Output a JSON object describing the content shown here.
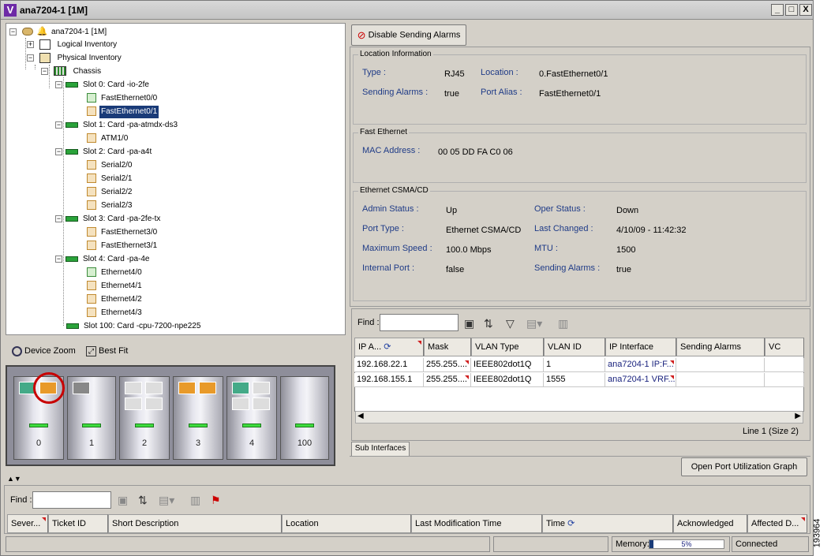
{
  "window": {
    "title": "ana7204-1 [1M]",
    "icon": "V",
    "min": "_",
    "max": "□",
    "close": "X"
  },
  "tree": {
    "root": "ana7204-1 [1M]",
    "logical": "Logical Inventory",
    "physical": "Physical Inventory",
    "chassis": "Chassis",
    "slot0": "Slot 0: Card -io-2fe",
    "slot0_p0": "FastEthernet0/0",
    "slot0_p1": "FastEthernet0/1",
    "slot1": "Slot 1: Card -pa-atmdx-ds3",
    "slot1_p0": "ATM1/0",
    "slot2": "Slot 2: Card -pa-a4t",
    "slot2_p0": "Serial2/0",
    "slot2_p1": "Serial2/1",
    "slot2_p2": "Serial2/2",
    "slot2_p3": "Serial2/3",
    "slot3": "Slot 3: Card -pa-2fe-tx",
    "slot3_p0": "FastEthernet3/0",
    "slot3_p1": "FastEthernet3/1",
    "slot4": "Slot 4: Card -pa-4e",
    "slot4_p0": "Ethernet4/0",
    "slot4_p1": "Ethernet4/1",
    "slot4_p2": "Ethernet4/2",
    "slot4_p3": "Ethernet4/3",
    "slot100": "Slot 100: Card -cpu-7200-npe225"
  },
  "zoom": {
    "device_zoom": "Device Zoom",
    "best_fit": "Best Fit"
  },
  "chassis_slots": [
    "0",
    "1",
    "2",
    "3",
    "4",
    "100"
  ],
  "top_button": {
    "label": "Disable Sending Alarms"
  },
  "location": {
    "title": "Location Information",
    "type_label": "Type :",
    "type_value": "RJ45",
    "location_label": "Location :",
    "location_value": "0.FastEthernet0/1",
    "alarms_label": "Sending Alarms :",
    "alarms_value": "true",
    "alias_label": "Port Alias :",
    "alias_value": "FastEthernet0/1"
  },
  "fast_ethernet": {
    "title": "Fast Ethernet",
    "mac_label": "MAC Address :",
    "mac_value": "00 05 DD FA C0 06"
  },
  "csma": {
    "title": "Ethernet CSMA/CD",
    "admin_label": "Admin Status :",
    "admin_value": "Up",
    "oper_label": "Oper Status :",
    "oper_value": "Down",
    "port_type_label": "Port Type :",
    "port_type_value": "Ethernet CSMA/CD",
    "changed_label": "Last Changed :",
    "changed_value": "4/10/09 - 11:42:32",
    "speed_label": "Maximum Speed :",
    "speed_value": "100.0 Mbps",
    "mtu_label": "MTU :",
    "mtu_value": "1500",
    "internal_label": "Internal Port :",
    "internal_value": "false",
    "alarms_label": "Sending Alarms :",
    "alarms_value": "true"
  },
  "subif": {
    "find_label": "Find :",
    "columns": [
      "IP A...",
      "Mask",
      "VLAN Type",
      "VLAN ID",
      "IP Interface",
      "Sending Alarms",
      "VC"
    ],
    "rows": [
      [
        "192.168.22.1",
        "255.255....",
        "IEEE802dot1Q",
        "1",
        "ana7204-1 IP:F...",
        "",
        ""
      ],
      [
        "192.168.155.1",
        "255.255....",
        "IEEE802dot1Q",
        "1555",
        "ana7204-1 VRF...",
        "",
        ""
      ]
    ],
    "status": "Line 1 (Size 2)",
    "tab": "Sub Interfaces",
    "graph_button": "Open Port Utilization Graph"
  },
  "tickets": {
    "find_label": "Find :",
    "columns": [
      "Sever...",
      "Ticket ID",
      "Short Description",
      "Location",
      "Last Modification Time",
      "Time",
      "Acknowledged",
      "Affected D..."
    ]
  },
  "statusbar": {
    "memory_label": "Memory:",
    "memory_value": "5%",
    "memory_fraction": 0.05,
    "connection": "Connected"
  },
  "side_stamp": "193964",
  "colors": {
    "selection": "#1a3b78",
    "label_blue": "#1f3b87",
    "led_green": "#3ddc3d"
  }
}
